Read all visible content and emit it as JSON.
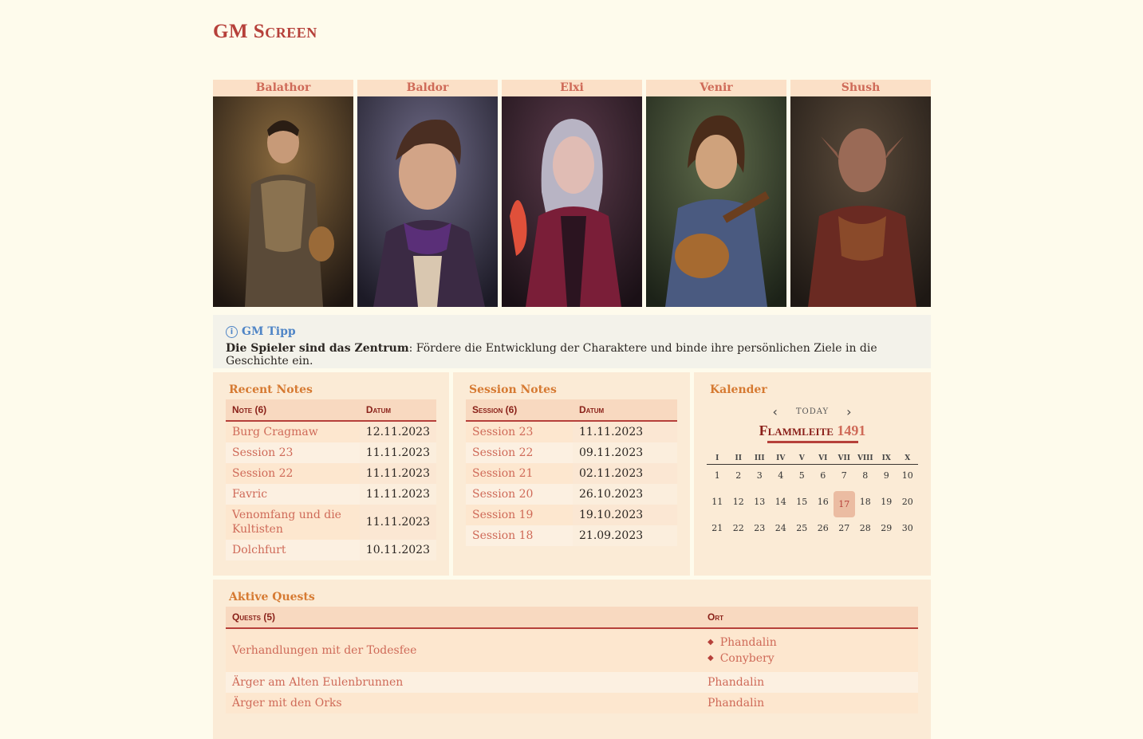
{
  "page": {
    "title": "GM Screen"
  },
  "characters": [
    {
      "name": "Balathor",
      "portrait": "armored-warrior-portrait"
    },
    {
      "name": "Baldor",
      "portrait": "rogue-portrait"
    },
    {
      "name": "Elxi",
      "portrait": "sorceress-portrait"
    },
    {
      "name": "Venir",
      "portrait": "bard-portrait"
    },
    {
      "name": "Shush",
      "portrait": "half-orc-portrait"
    }
  ],
  "tip": {
    "title": "GM Tipp",
    "bold": "Die Spieler sind das Zentrum",
    "text": ": Fördere die Entwicklung der Charaktere und binde ihre persönlichen Ziele in die Geschichte ein."
  },
  "recent_notes": {
    "title": "Recent Notes",
    "col_note": "Note (6)",
    "col_date": "Datum",
    "rows": [
      {
        "name": "Burg Cragmaw",
        "date": "12.11.2023"
      },
      {
        "name": "Session 23",
        "date": "11.11.2023"
      },
      {
        "name": "Session 22",
        "date": "11.11.2023"
      },
      {
        "name": "Favric",
        "date": "11.11.2023"
      },
      {
        "name": "Venomfang und die Kultisten",
        "date": "11.11.2023"
      },
      {
        "name": "Dolchfurt",
        "date": "10.11.2023"
      }
    ]
  },
  "session_notes": {
    "title": "Session Notes",
    "col_session": "Session (6)",
    "col_date": "Datum",
    "rows": [
      {
        "name": "Session 23",
        "date": "11.11.2023"
      },
      {
        "name": "Session 22",
        "date": "09.11.2023"
      },
      {
        "name": "Session 21",
        "date": "02.11.2023"
      },
      {
        "name": "Session 20",
        "date": "26.10.2023"
      },
      {
        "name": "Session 19",
        "date": "19.10.2023"
      },
      {
        "name": "Session 18",
        "date": "21.09.2023"
      }
    ]
  },
  "calendar": {
    "title": "Kalender",
    "today_label": "today",
    "month": "Flammleite",
    "year": "1491",
    "weekdays": [
      "I",
      "II",
      "III",
      "IV",
      "V",
      "VI",
      "VII",
      "VIII",
      "IX",
      "X"
    ],
    "days": [
      "1",
      "2",
      "3",
      "4",
      "5",
      "6",
      "7",
      "8",
      "9",
      "10",
      "11",
      "12",
      "13",
      "14",
      "15",
      "16",
      "17",
      "18",
      "19",
      "20",
      "21",
      "22",
      "23",
      "24",
      "25",
      "26",
      "27",
      "28",
      "29",
      "30"
    ],
    "today": "17"
  },
  "quests": {
    "title": "Aktive Quests",
    "col_quest": "Quests (5)",
    "col_ort": "Ort",
    "rows": [
      {
        "name": "Verhandlungen mit der Todesfee",
        "orte": [
          "Phandalin",
          "Conybery"
        ]
      },
      {
        "name": "Ärger am Alten Eulenbrunnen",
        "orte": [
          "Phandalin"
        ]
      },
      {
        "name": "Ärger mit den Orks",
        "orte": [
          "Phandalin"
        ]
      }
    ]
  },
  "colors": {
    "accent": "#b6403a",
    "link": "#cf6a58",
    "section_title": "#d67a32",
    "background": "#fefbec"
  }
}
